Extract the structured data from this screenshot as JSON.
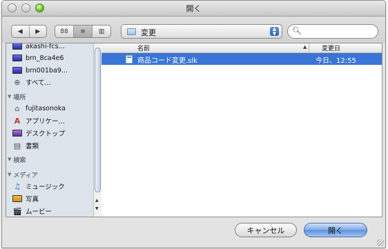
{
  "window": {
    "title": "開く"
  },
  "toolbar": {
    "back_icon": "◀",
    "forward_icon": "▶",
    "view_icon_glyph": "88",
    "view_list_glyph": "≡",
    "view_column_glyph": "▥",
    "location": "変更",
    "search_placeholder": ""
  },
  "sidebar": {
    "devices": [
      "akashi-fcs...",
      "brn_8ca4e6",
      "brn001ba9..."
    ],
    "all": "すべて...",
    "places_header": "場所",
    "places": [
      "fujitasonoka",
      "アプリケー…",
      "デスクトップ",
      "書類"
    ],
    "search_header": "検索",
    "media_header": "メディア",
    "media": [
      "ミュージック",
      "写真",
      "ムービー"
    ]
  },
  "files": {
    "col_name": "名前",
    "col_date": "変更日",
    "rows": [
      {
        "name": "商品コード変更.slk",
        "date": "今日、12:55"
      }
    ]
  },
  "buttons": {
    "cancel": "キャンセル",
    "open": "開く"
  },
  "colors": {
    "selection": "#3a75d6",
    "sidebar_bg": "#dde4ec"
  }
}
